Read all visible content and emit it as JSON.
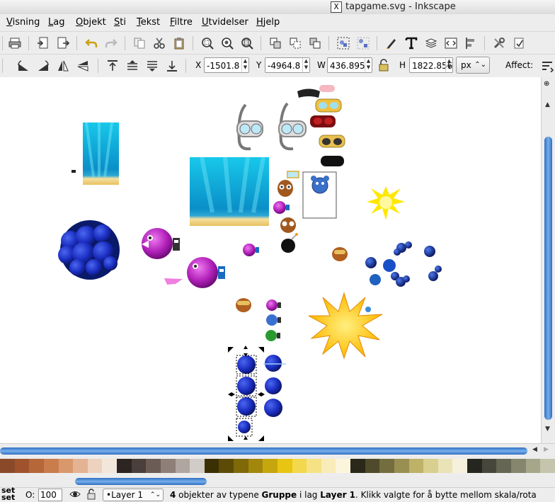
{
  "window": {
    "title": "tapgame.svg - Inkscape",
    "title_icon": "x-window-icon"
  },
  "menu": [
    "Visning",
    "Lag",
    "Objekt",
    "Sti",
    "Tekst",
    "Filtre",
    "Utvidelser",
    "Hjelp"
  ],
  "menu_underline": [
    "V",
    "L",
    "O",
    "S",
    "T",
    "F",
    "U",
    "H"
  ],
  "toolbar": {
    "x_label": "X",
    "x_value": "-1501.8",
    "y_label": "Y",
    "y_value": "-4964.8",
    "w_label": "W",
    "w_value": "436.895",
    "h_label": "H",
    "h_value": "1822.856",
    "unit": "px",
    "affect_label": "Affect:"
  },
  "icons": {
    "row1": [
      "print-icon",
      "import-icon",
      "export-icon",
      "undo-icon",
      "redo-icon",
      "copy-icon",
      "cut-icon",
      "paste-icon",
      "zoom-selection-icon",
      "zoom-drawing-icon",
      "zoom-page-icon",
      "duplicate-icon",
      "clone-icon",
      "unlink-clone-icon",
      "group-icon",
      "ungroup-icon",
      "fill-stroke-icon",
      "text-icon",
      "layers-icon",
      "xml-editor-icon",
      "align-icon",
      "preferences-icon",
      "document-properties-icon"
    ],
    "row2": [
      "rotate-ccw-icon",
      "rotate-cw-icon",
      "flip-horizontal-icon",
      "flip-vertical-icon",
      "raise-to-top-icon",
      "raise-icon",
      "lower-icon",
      "lower-to-bottom-icon",
      "lock-icon",
      "scale-stroke-icon"
    ]
  },
  "palette": [
    "#8a4a2a",
    "#a0522d",
    "#b5673a",
    "#c97c4c",
    "#d9986c",
    "#e4b394",
    "#ecd2bf",
    "#f3e6da",
    "#2b2421",
    "#4a3f3a",
    "#6b5d55",
    "#8e8078",
    "#b0a59f",
    "#d2ccc8",
    "#3a3004",
    "#5c4b06",
    "#7f6909",
    "#a2870c",
    "#c5a60f",
    "#e8c512",
    "#f3d84d",
    "#f6e283",
    "#f9ecb8",
    "#fcf5dc",
    "#2a2818",
    "#4f4a2b",
    "#746d3f",
    "#998f53",
    "#bdb268",
    "#d9cf8e",
    "#ebe3b8",
    "#f5f1dc",
    "#262620",
    "#46463a",
    "#666654",
    "#86866f",
    "#a6a68a",
    "#c5c5ad"
  ],
  "status": {
    "left_top": "set",
    "left_bottom": "set",
    "opacity_label": "O:",
    "opacity_value": "100",
    "layer": "•Layer 1",
    "message_prefix": "4",
    "message_1": " objekter av typene ",
    "message_bold_1": "Gruppe",
    "message_2": " i lag ",
    "message_bold_2": "Layer 1",
    "message_3": ". Klikk valgte for å bytte mellom skala/rota"
  },
  "colors": {
    "accent": "#3473c6",
    "canvas": "#ffffff",
    "chrome": "#ededed"
  }
}
